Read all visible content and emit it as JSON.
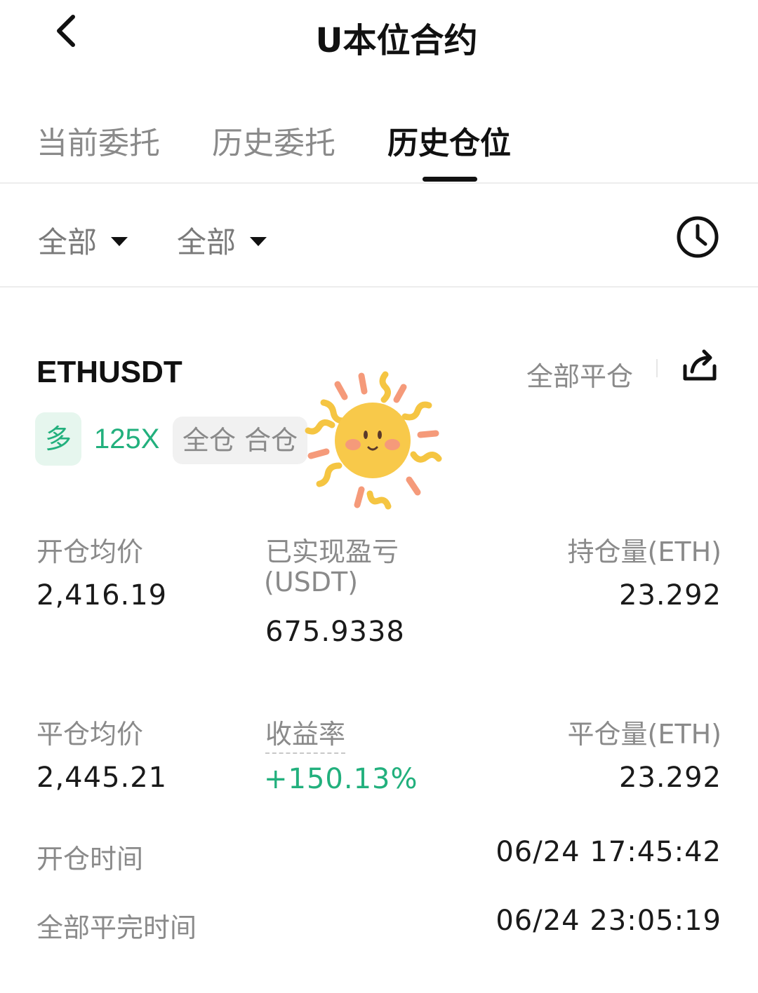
{
  "header": {
    "title": "U本位合约",
    "back_icon": "chevron-left-icon"
  },
  "tabs": [
    {
      "label": "当前委托",
      "active": false
    },
    {
      "label": "历史委托",
      "active": false
    },
    {
      "label": "历史仓位",
      "active": true
    }
  ],
  "filters": {
    "first": "全部",
    "second": "全部",
    "history_icon": "clock-icon"
  },
  "position": {
    "symbol": "ETHUSDT",
    "close_all_label": "全部平仓",
    "share_icon": "share-icon",
    "side_tag": "多",
    "leverage": "125X",
    "mode_tag": "全仓 合仓",
    "open_avg_label": "开仓均价",
    "open_avg_value": "2,416.19",
    "realized_pnl_label_line1": "已实现盈亏",
    "realized_pnl_label_line2": "(USDT)",
    "realized_pnl_value": "675.9338",
    "holding_label": "持仓量(ETH)",
    "holding_value": "23.292",
    "close_avg_label": "平仓均价",
    "close_avg_value": "2,445.21",
    "roi_label": "收益率",
    "roi_value": "+150.13%",
    "closed_qty_label": "平仓量(ETH)",
    "closed_qty_value": "23.292",
    "open_time_label": "开仓时间",
    "open_time_value": "06/24 17:45:42",
    "close_time_label": "全部平完时间",
    "close_time_value": "06/24 23:05:19"
  },
  "colors": {
    "accent_green": "#22b07d",
    "text_primary": "#1a1a1a",
    "text_secondary": "#8a8a8a"
  }
}
